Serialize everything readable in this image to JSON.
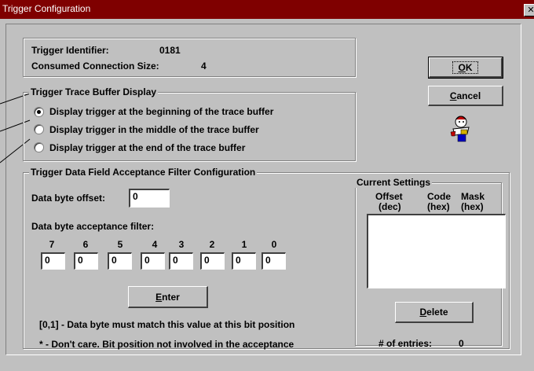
{
  "window": {
    "title": "Trigger Configuration",
    "close_glyph": "✕"
  },
  "info": {
    "identifier_label": "Trigger Identifier:",
    "identifier_value": "0181",
    "size_label": "Consumed Connection Size:",
    "size_value": "4"
  },
  "buttons": {
    "ok_mnemonic": "O",
    "ok_rest": "K",
    "cancel_mnemonic": "C",
    "cancel_rest": "ancel",
    "enter_mnemonic": "E",
    "enter_rest": "nter",
    "delete_mnemonic": "D",
    "delete_rest": "elete"
  },
  "trace": {
    "legend": "Trigger Trace Buffer Display",
    "options": [
      {
        "label": "Display trigger at the beginning of the trace buffer",
        "selected": true
      },
      {
        "label": "Display trigger in the middle of the trace buffer",
        "selected": false
      },
      {
        "label": "Display trigger at the end of the trace buffer",
        "selected": false
      }
    ]
  },
  "filter": {
    "legend": "Trigger Data Field Acceptance Filter Configuration",
    "offset_label": "Data byte offset:",
    "offset_value": "0",
    "acceptance_label": "Data byte acceptance filter:",
    "bits": [
      {
        "label": "7",
        "value": "0"
      },
      {
        "label": "6",
        "value": "0"
      },
      {
        "label": "5",
        "value": "0"
      },
      {
        "label": "4",
        "value": "0"
      },
      {
        "label": "3",
        "value": "0"
      },
      {
        "label": "2",
        "value": "0"
      },
      {
        "label": "1",
        "value": "0"
      },
      {
        "label": "0",
        "value": "0"
      }
    ],
    "note1": "[0,1] - Data byte must match this value at this bit position",
    "note2": "* - Don't care.  Bit position not involved in the acceptance"
  },
  "current": {
    "legend": "Current Settings",
    "col_offset": "Offset",
    "col_offset_sub": "(dec)",
    "col_code": "Code",
    "col_code_sub": "(hex)",
    "col_mask": "Mask",
    "col_mask_sub": "(hex)",
    "entries": [],
    "entries_label": "# of entries:",
    "entries_count": "0"
  },
  "icons": {
    "app": "wizard-figure-icon"
  },
  "colors": {
    "titlebar": "#7f0000",
    "face": "#c0c0c0"
  }
}
